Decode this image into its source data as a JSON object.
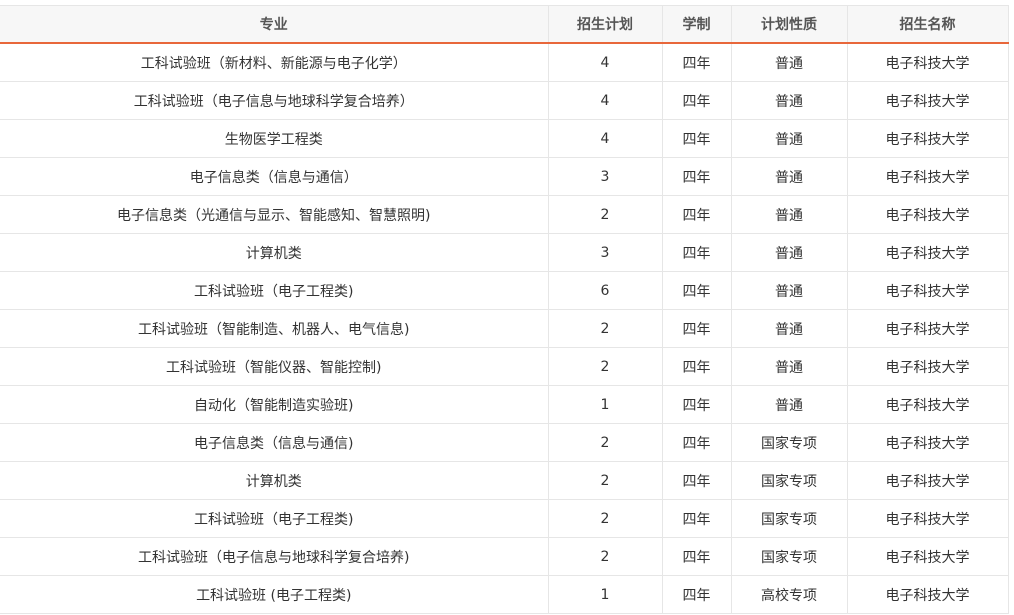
{
  "table": {
    "headers": [
      "专业",
      "招生计划",
      "学制",
      "计划性质",
      "招生名称"
    ],
    "rows": [
      [
        "工科试验班（新材料、新能源与电子化学）",
        "4",
        "四年",
        "普通",
        "电子科技大学"
      ],
      [
        "工科试验班（电子信息与地球科学复合培养）",
        "4",
        "四年",
        "普通",
        "电子科技大学"
      ],
      [
        "生物医学工程类",
        "4",
        "四年",
        "普通",
        "电子科技大学"
      ],
      [
        "电子信息类（信息与通信）",
        "3",
        "四年",
        "普通",
        "电子科技大学"
      ],
      [
        "电子信息类（光通信与显示、智能感知、智慧照明)",
        "2",
        "四年",
        "普通",
        "电子科技大学"
      ],
      [
        "计算机类",
        "3",
        "四年",
        "普通",
        "电子科技大学"
      ],
      [
        "工科试验班（电子工程类)",
        "6",
        "四年",
        "普通",
        "电子科技大学"
      ],
      [
        "工科试验班（智能制造、机器人、电气信息)",
        "2",
        "四年",
        "普通",
        "电子科技大学"
      ],
      [
        "工科试验班（智能仪器、智能控制)",
        "2",
        "四年",
        "普通",
        "电子科技大学"
      ],
      [
        "自动化（智能制造实验班)",
        "1",
        "四年",
        "普通",
        "电子科技大学"
      ],
      [
        "电子信息类（信息与通信)",
        "2",
        "四年",
        "国家专项",
        "电子科技大学"
      ],
      [
        "计算机类",
        "2",
        "四年",
        "国家专项",
        "电子科技大学"
      ],
      [
        "工科试验班（电子工程类)",
        "2",
        "四年",
        "国家专项",
        "电子科技大学"
      ],
      [
        "工科试验班（电子信息与地球科学复合培养)",
        "2",
        "四年",
        "国家专项",
        "电子科技大学"
      ],
      [
        "工科试验班 (电子工程类)",
        "1",
        "四年",
        "高校专项",
        "电子科技大学"
      ]
    ]
  },
  "colors": {
    "header_bg": "#f7f7f7",
    "accent_underline": "#e8673b",
    "border": "#e6e6e6",
    "text": "#333333"
  }
}
